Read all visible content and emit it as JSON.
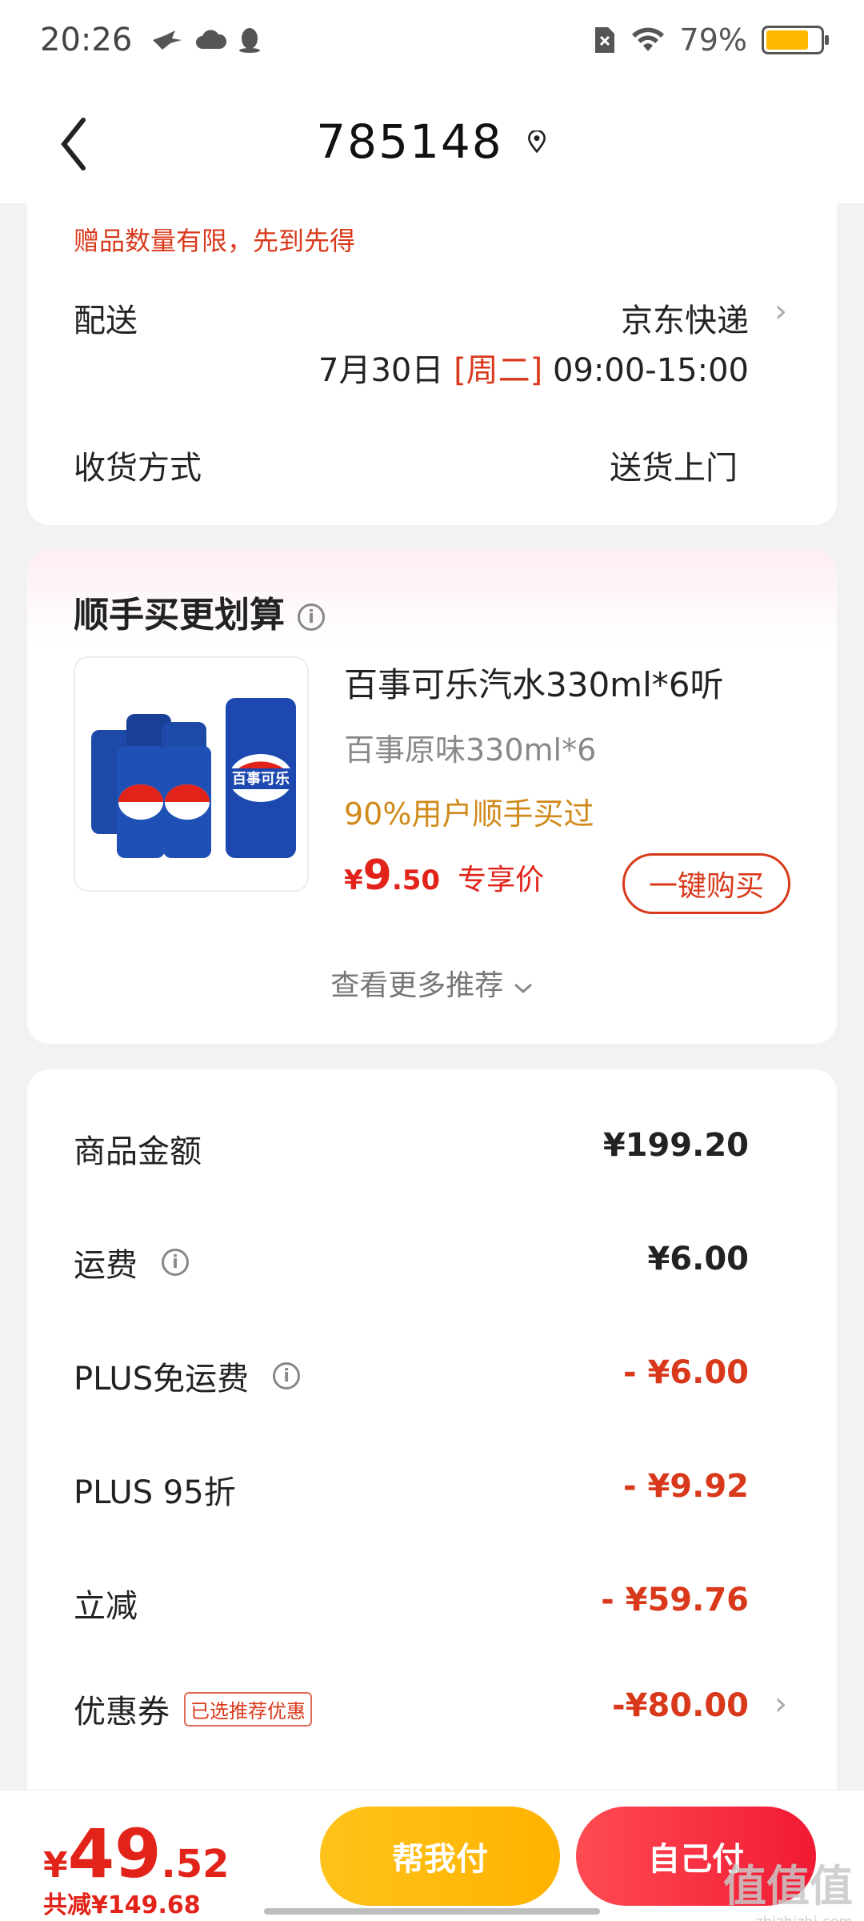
{
  "status_bar": {
    "time": "20:26",
    "battery": "79%",
    "battery_level": 0.79
  },
  "header": {
    "title": "785148",
    "back_icon": "chevron-left-icon",
    "location_icon": "location-pin-icon"
  },
  "delivery": {
    "gift_note": "赠品数量有限，先到先得",
    "delivery_label": "配送",
    "carrier": "京东快递",
    "date": "7月30日",
    "weekday": "[周二]",
    "time_window": "09:00-15:00",
    "receive_label": "收货方式",
    "receive_value": "送货上门"
  },
  "recommend": {
    "title": "顺手买更划算",
    "product_name": "百事可乐汽水330ml*6听",
    "product_spec": "百事原味330ml*6",
    "hint": "90%用户顺手买过",
    "price_currency": "¥",
    "price_int": "9",
    "price_dec": ".50",
    "price_tag": "专享价",
    "buy_label": "一键购买",
    "more_label": "查看更多推荐",
    "product_image_text": "百事可乐"
  },
  "fees": {
    "rows": [
      {
        "label": "商品金额",
        "value": "¥199.20",
        "info": false,
        "red": false
      },
      {
        "label": "运费",
        "value": "¥6.00",
        "info": true,
        "red": false
      },
      {
        "label": "PLUS免运费",
        "value": "- ¥6.00",
        "info": true,
        "red": true
      },
      {
        "label": "PLUS 95折",
        "value": "- ¥9.92",
        "info": false,
        "red": true
      },
      {
        "label": "立减",
        "value": "- ¥59.76",
        "info": false,
        "red": true
      }
    ],
    "coupon_label": "优惠券",
    "coupon_tag": "已选推荐优惠",
    "coupon_value": "-¥80.00"
  },
  "bottom": {
    "total_currency": "¥",
    "total_int": "49",
    "total_dec": ".52",
    "saved": "共减¥149.68",
    "help_pay": "帮我付",
    "self_pay": "自己付",
    "watermark": "值值值",
    "watermark_sub": "zhizhizhi.com"
  }
}
